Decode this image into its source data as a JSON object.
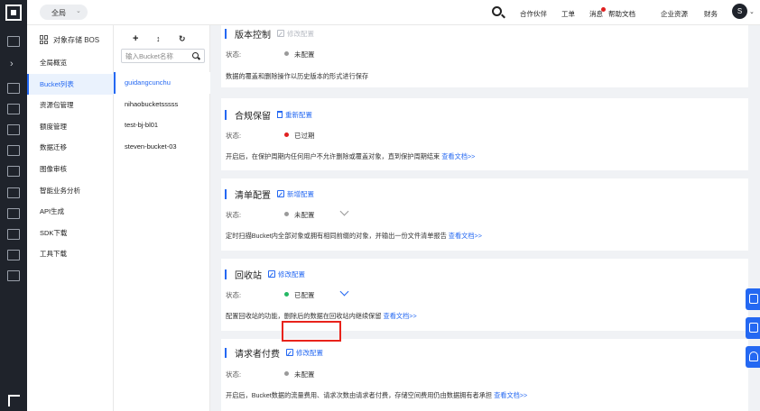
{
  "topbar": {
    "scope_label": "全局",
    "nav": [
      "合作伙伴",
      "工单",
      "消息",
      "帮助文档",
      "企业资源",
      "财务"
    ],
    "avatar_letter": "S"
  },
  "product_sidebar": {
    "title": "对象存储 BOS",
    "items": [
      "全局概览",
      "Bucket列表",
      "资源包管理",
      "额度管理",
      "数据迁移",
      "图像审核",
      "智能业务分析",
      "API生成",
      "SDK下载",
      "工具下载"
    ],
    "active_index": 1
  },
  "bucket_panel": {
    "tools": [
      "+",
      "↕",
      "↻"
    ],
    "search_placeholder": "输入Bucket名称",
    "buckets": [
      "guidangcunchu",
      "nihaobucketsssss",
      "test-bj-bl01",
      "steven-bucket-03"
    ],
    "active_index": 0
  },
  "sections": {
    "version": {
      "title": "版本控制",
      "action": "修改配置",
      "status_label": "状态:",
      "status": "未配置",
      "status_color": "#9a9a9a",
      "desc": "数据的覆盖和删除操作以历史版本的形式进行保存"
    },
    "compliance": {
      "title": "合规保留",
      "action": "重新配置",
      "status_label": "状态:",
      "status": "已过期",
      "status_color": "#e02020",
      "desc": "开启后，在保护周期内任何用户不允许删除或覆盖对象，直到保护周期结束",
      "link": "查看文档>>"
    },
    "inventory": {
      "title": "清单配置",
      "action": "新增配置",
      "status_label": "状态:",
      "status": "未配置",
      "status_color": "#9a9a9a",
      "desc": "定时扫描Bucket内全部对象或拥有相同前缀的对象，并输出一份文件清单报告",
      "link": "查看文档>>"
    },
    "recycle": {
      "title": "回收站",
      "action": "修改配置",
      "status_label": "状态:",
      "status": "已配置",
      "status_color": "#25b864",
      "desc": "配置回收站的功能，删除后的数据在回收站内继续保留",
      "link": "查看文档>>"
    },
    "requester_pays": {
      "title": "请求者付费",
      "action": "修改配置",
      "status_label": "状态:",
      "status": "未配置",
      "status_color": "#9a9a9a",
      "desc": "开启后，Bucket数据的流量费用、请求次数由请求者付费，存储空间费用仍由数据拥有者承担",
      "link": "查看文档>>"
    }
  },
  "colors": {
    "accent": "#2468f2",
    "highlight": "#e8231b"
  }
}
